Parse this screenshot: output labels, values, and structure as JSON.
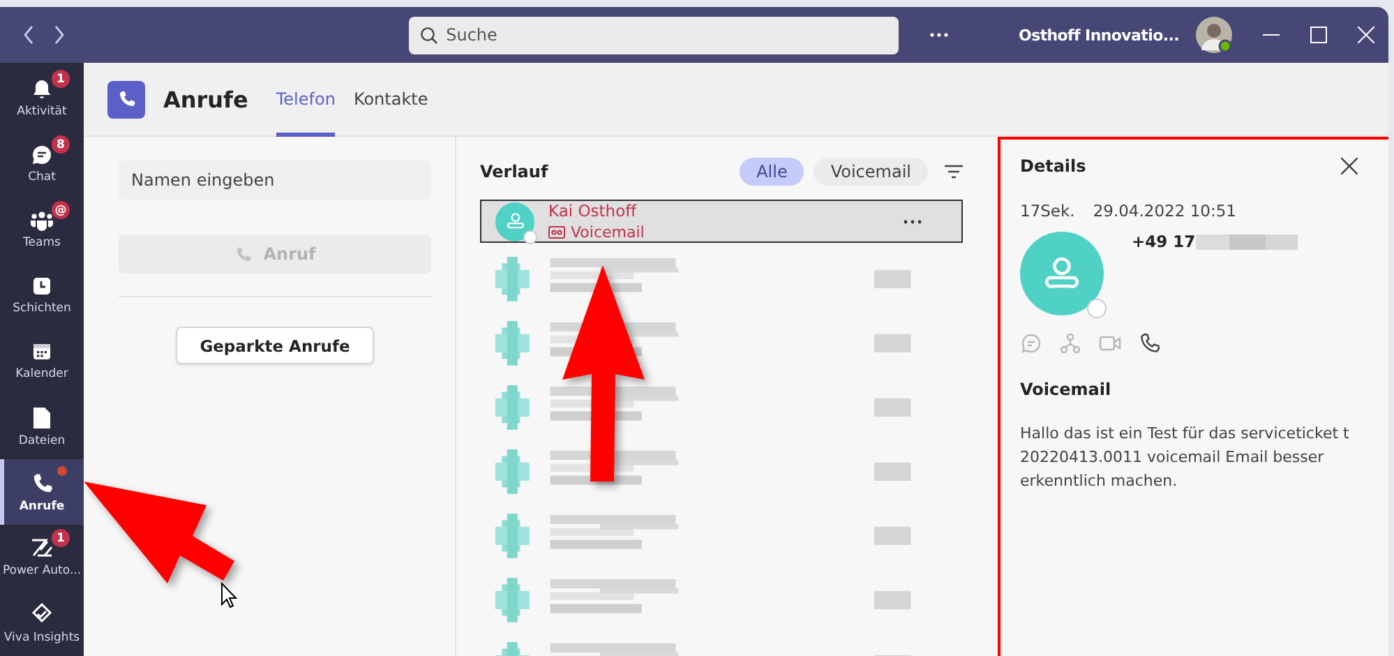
{
  "titlebar": {
    "search": {
      "placeholder": "Suche"
    },
    "org_name": "Osthoff Innovatio..."
  },
  "app_bar": [
    {
      "label": "Aktivität",
      "badge": "1",
      "dot": false,
      "selected": false
    },
    {
      "label": "Chat",
      "badge": "8",
      "dot": false,
      "selected": false
    },
    {
      "label": "Teams",
      "badge": "@",
      "dot": false,
      "selected": false
    },
    {
      "label": "Schichten",
      "dot": false,
      "selected": false
    },
    {
      "label": "Kalender",
      "dot": false,
      "selected": false
    },
    {
      "label": "Dateien",
      "dot": false,
      "selected": false
    },
    {
      "label": "Anrufe",
      "dot": true,
      "selected": true
    },
    {
      "label": "Power Auto...",
      "badge": "1",
      "dot": false,
      "selected": false
    },
    {
      "label": "Viva Insights",
      "dot": false,
      "selected": false
    }
  ],
  "header": {
    "title": "Anrufe",
    "tabs": [
      {
        "label": "Telefon",
        "selected": true
      },
      {
        "label": "Kontakte",
        "selected": false
      }
    ]
  },
  "dial_pane": {
    "name_field": {
      "placeholder": "Namen eingeben"
    },
    "call_button": {
      "label": "Anruf",
      "disabled": true
    },
    "parked_button": "Geparkte Anrufe"
  },
  "history": {
    "title": "Verlauf",
    "filters": [
      {
        "label": "Alle",
        "selected": true
      },
      {
        "label": "Voicemail",
        "selected": false
      }
    ],
    "entries": [
      {
        "kind": "call",
        "name": "Kai Osthoff",
        "type": "Voicemail",
        "selected": true
      },
      {
        "kind": "blurred"
      },
      {
        "kind": "blurred"
      },
      {
        "kind": "blurred"
      },
      {
        "kind": "blurred"
      },
      {
        "kind": "blurred"
      },
      {
        "kind": "blurred"
      },
      {
        "kind": "blurred"
      }
    ]
  },
  "details": {
    "title": "Details",
    "highlighted": true,
    "duration": "17Sek.",
    "datetime": "29.04.2022 10:51",
    "phone": "+49 17",
    "phone_blurred": true,
    "actions": [
      {
        "disabled": true
      },
      {
        "disabled": true
      },
      {
        "disabled": true
      },
      {
        "disabled": false
      }
    ],
    "section_title": "Voicemail",
    "transcript": "Hallo das ist ein Test für das serviceticket t 20220413.0011 voicemail Email besser erkenntlich machen."
  },
  "annotations": [
    {
      "kind": "arrow_up_left"
    },
    {
      "kind": "arrow_up"
    },
    {
      "kind": "cursor"
    }
  ]
}
